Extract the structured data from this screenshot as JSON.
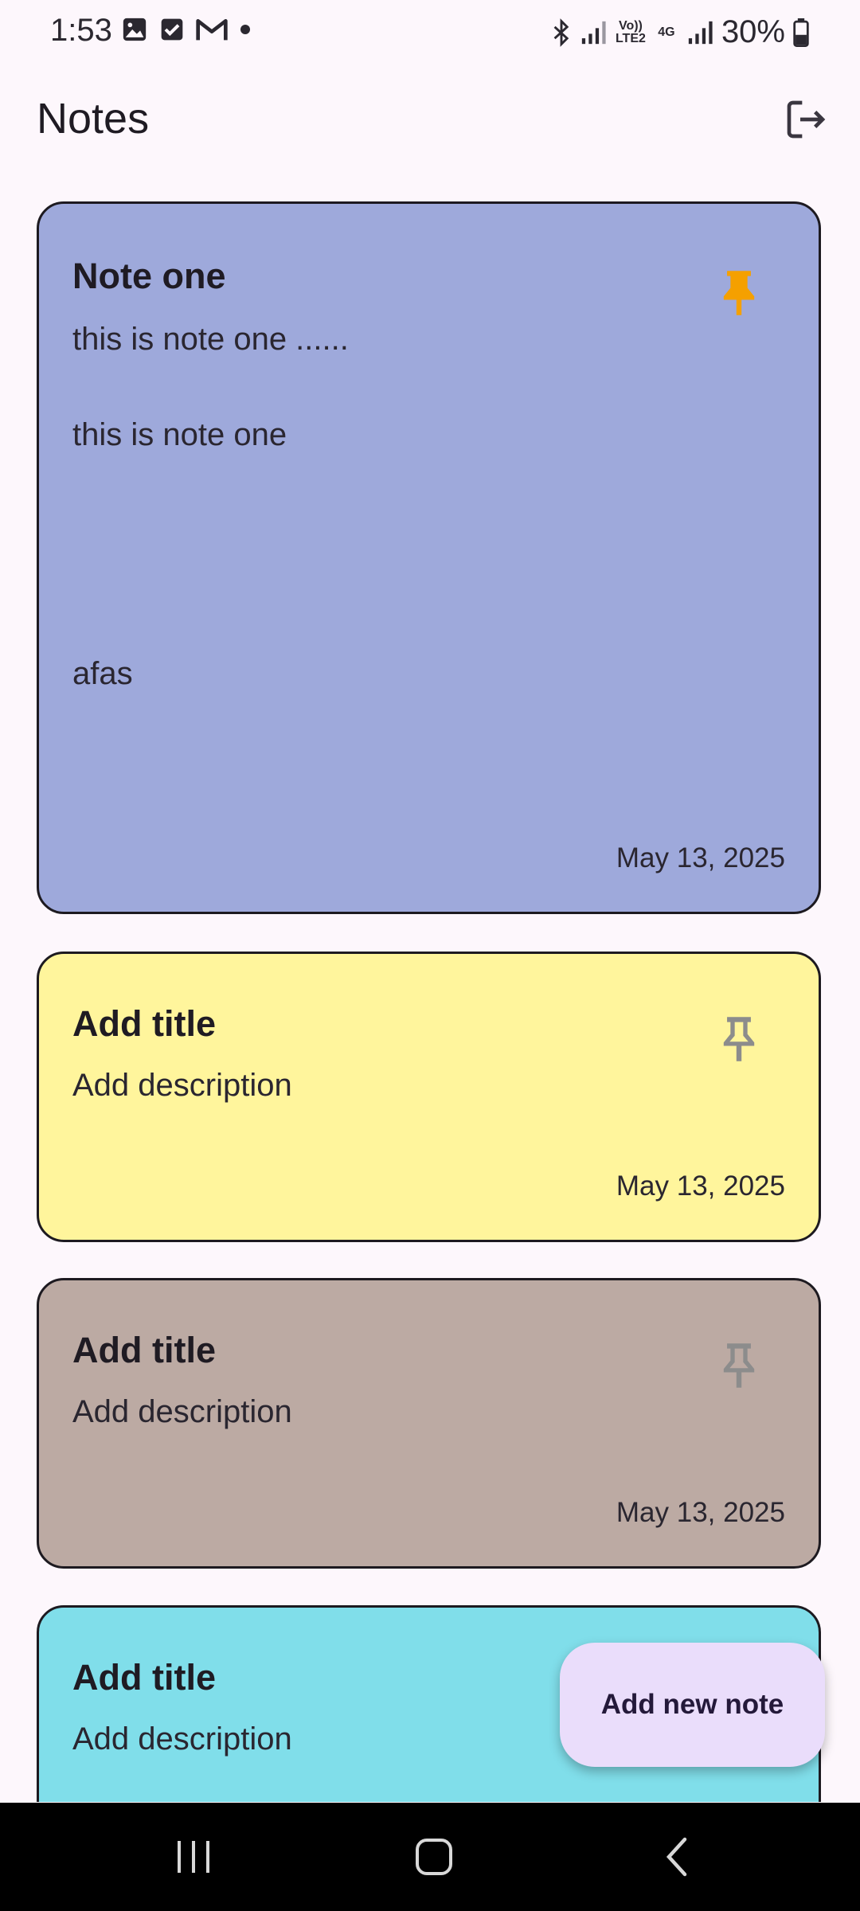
{
  "status_bar": {
    "time": "1:53",
    "left_icons": [
      "image-icon",
      "checkbox-icon",
      "gmail-icon",
      "dot-icon"
    ],
    "right_icons": [
      "bluetooth-icon",
      "signal-icon",
      "volte-icon",
      "4g-icon",
      "signal-icon"
    ],
    "volte_label": "Vo)) LTE2",
    "net_label": "4G",
    "battery": "30%"
  },
  "header": {
    "title": "Notes",
    "action_icon": "logout-icon"
  },
  "notes": [
    {
      "title": "Note one",
      "description_lines": [
        "this is note one ......",
        "",
        "this is  note one",
        "",
        "",
        "",
        "",
        "afas"
      ],
      "date": "May 13, 2025",
      "pinned": true,
      "color": "#9ea9db"
    },
    {
      "title": "Add title",
      "description_lines": [
        "Add description"
      ],
      "date": "May 13, 2025",
      "pinned": false,
      "color": "#fff59c"
    },
    {
      "title": "Add title",
      "description_lines": [
        "Add description"
      ],
      "date": "May 13, 2025",
      "pinned": false,
      "color": "#bcaaa3"
    },
    {
      "title": "Add title",
      "description_lines": [
        "Add description"
      ],
      "date": "",
      "pinned": false,
      "color": "#80deea"
    }
  ],
  "fab": {
    "label": "Add new note"
  },
  "nav": {
    "icons": [
      "recents-icon",
      "home-icon",
      "back-icon"
    ]
  },
  "colors": {
    "pin_active": "#f5a000",
    "pin_inactive": "#8c8c8c",
    "background": "#fdf7fc",
    "fab": "#eaddfb"
  }
}
